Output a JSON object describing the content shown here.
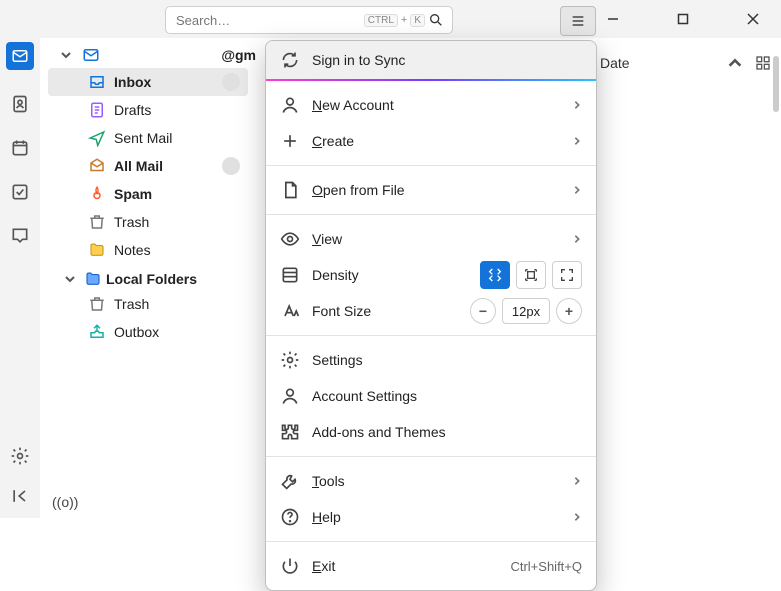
{
  "titlebar": {
    "search_placeholder": "Search…",
    "kbd1": "CTRL",
    "kbd_plus": "+",
    "kbd2": "K"
  },
  "sidebar": {
    "account_label": "@gm",
    "folders": [
      {
        "label": "Inbox",
        "bold": true,
        "color": "#1373d9"
      },
      {
        "label": "Drafts",
        "bold": false,
        "color": "#9a5cff"
      },
      {
        "label": "Sent Mail",
        "bold": false,
        "color": "#1aa36a"
      },
      {
        "label": "All Mail",
        "bold": true,
        "color": "#c77a2b"
      },
      {
        "label": "Spam",
        "bold": true,
        "color": "#ff5a2b"
      },
      {
        "label": "Trash",
        "bold": false,
        "color": "#777"
      },
      {
        "label": "Notes",
        "bold": false,
        "color": "#e0a しく0"
      }
    ],
    "local_header": "Local Folders",
    "local": [
      {
        "label": "Trash",
        "color": "#777"
      },
      {
        "label": "Outbox",
        "color": "#17b1a4"
      }
    ]
  },
  "column_header": {
    "label": "Date"
  },
  "menu": {
    "sync": "Sign in to Sync",
    "new_account": "New Account",
    "create": "Create",
    "open_file": "Open from File",
    "view": "View",
    "density": "Density",
    "font_size": "Font Size",
    "font_value": "12px",
    "settings": "Settings",
    "acct_settings": "Account Settings",
    "addons": "Add-ons and Themes",
    "tools": "Tools",
    "help": "Help",
    "exit": "Exit",
    "exit_accel": "Ctrl+Shift+Q"
  },
  "netstatus": "((o))"
}
